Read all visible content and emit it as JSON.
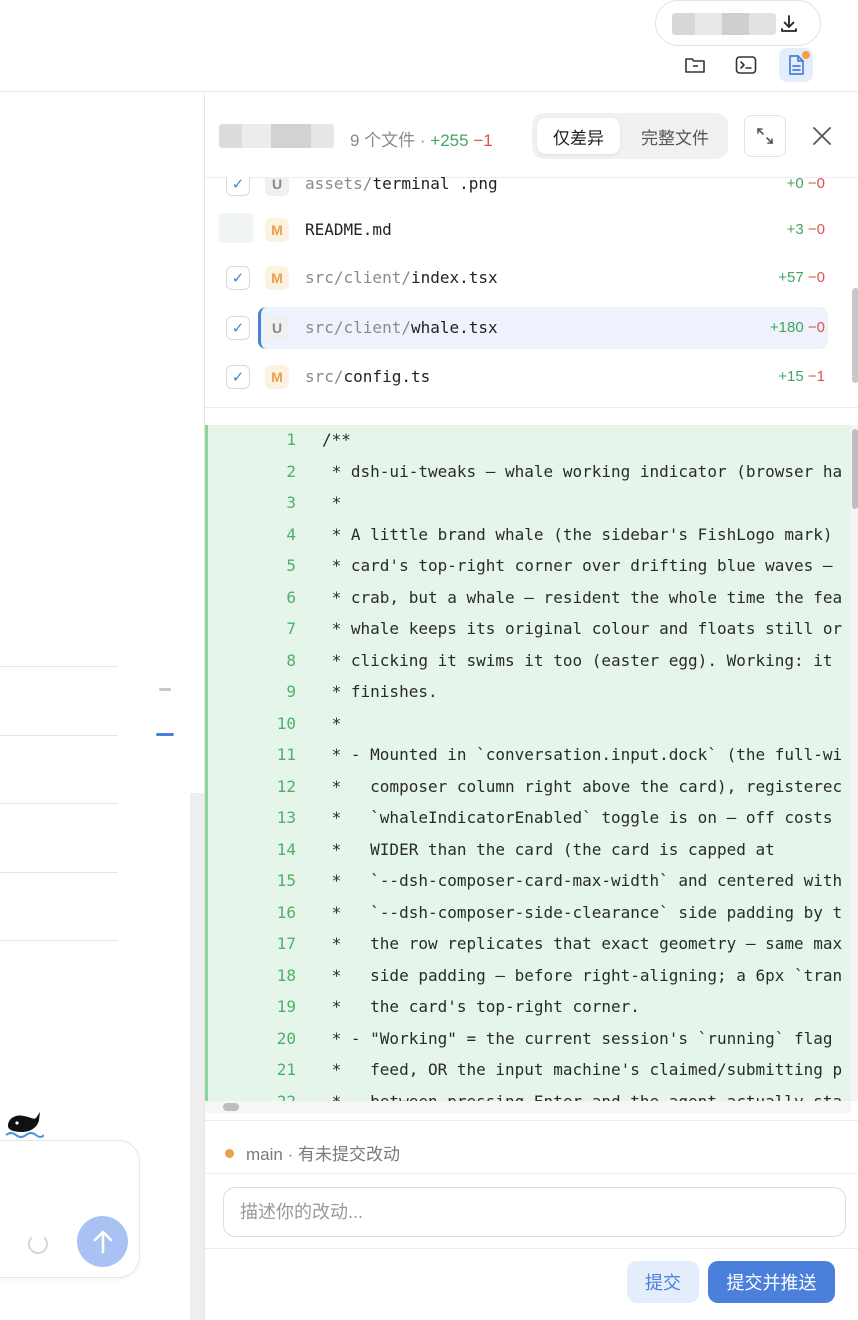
{
  "topbar": {
    "download_icon": "download-icon",
    "tools": [
      {
        "icon": "folder-icon",
        "active": false
      },
      {
        "icon": "terminal-icon",
        "active": false
      },
      {
        "icon": "document-icon",
        "active": true
      }
    ]
  },
  "diff": {
    "file_count": "9 个文件 · ",
    "total_added": "+255",
    "total_removed": "−1",
    "view_toggle": {
      "diff_only": "仅差异",
      "full_file": "完整文件"
    },
    "files": [
      {
        "status": "U",
        "dir": "assets/",
        "name": "terminal .png",
        "added": "+0",
        "removed": "−0",
        "checked": true
      },
      {
        "status": "M",
        "dir": "",
        "name": "README.md",
        "added": "+3",
        "removed": "−0",
        "checked": false
      },
      {
        "status": "M",
        "dir": "src/client/",
        "name": "index.tsx",
        "added": "+57",
        "removed": "−0",
        "checked": true
      },
      {
        "status": "U",
        "dir": "src/client/",
        "name": "whale.tsx",
        "added": "+180",
        "removed": "−0",
        "checked": true,
        "selected": true
      },
      {
        "status": "M",
        "dir": "src/",
        "name": "config.ts",
        "added": "+15",
        "removed": "−1",
        "checked": true
      }
    ],
    "code_lines": [
      {
        "n": "1",
        "text": "/**"
      },
      {
        "n": "2",
        "text": " * dsh-ui-tweaks — whale working indicator (browser ha"
      },
      {
        "n": "3",
        "text": " *"
      },
      {
        "n": "4",
        "text": " * A little brand whale (the sidebar's FishLogo mark)"
      },
      {
        "n": "5",
        "text": " * card's top-right corner over drifting blue waves —"
      },
      {
        "n": "6",
        "text": " * crab, but a whale — resident the whole time the fea"
      },
      {
        "n": "7",
        "text": " * whale keeps its original colour and floats still or"
      },
      {
        "n": "8",
        "text": " * clicking it swims it too (easter egg). Working: it"
      },
      {
        "n": "9",
        "text": " * finishes."
      },
      {
        "n": "10",
        "text": " *"
      },
      {
        "n": "11",
        "text": " * - Mounted in `conversation.input.dock` (the full-wi"
      },
      {
        "n": "12",
        "text": " *   composer column right above the card), registerec"
      },
      {
        "n": "13",
        "text": " *   `whaleIndicatorEnabled` toggle is on — off costs"
      },
      {
        "n": "14",
        "text": " *   WIDER than the card (the card is capped at"
      },
      {
        "n": "15",
        "text": " *   `--dsh-composer-card-max-width` and centered with"
      },
      {
        "n": "16",
        "text": " *   `--dsh-composer-side-clearance` side padding by t"
      },
      {
        "n": "17",
        "text": " *   the row replicates that exact geometry — same max"
      },
      {
        "n": "18",
        "text": " *   side padding — before right-aligning; a 6px `tran"
      },
      {
        "n": "19",
        "text": " *   the card's top-right corner."
      },
      {
        "n": "20",
        "text": " * - \"Working\" = the current session's `running` flag"
      },
      {
        "n": "21",
        "text": " *   feed, OR the input machine's claimed/submitting p"
      },
      {
        "n": "22",
        "text": " *   between pressing Enter and the agent actually sta"
      }
    ]
  },
  "git": {
    "branch_status": "main · 有未提交改动",
    "commit_placeholder": "描述你的改动...",
    "commit_label": "提交",
    "commit_push_label": "提交并推送"
  },
  "colors": {
    "accent": "#4a7fdc",
    "added": "#3fa760",
    "removed": "#d9534f",
    "modified": "#e9a04a"
  }
}
